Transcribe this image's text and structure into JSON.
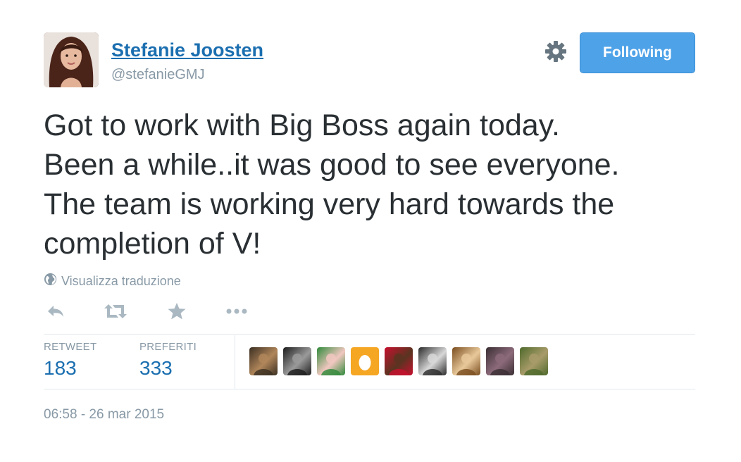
{
  "user": {
    "name": "Stefanie Joosten",
    "handle": "@stefanieGMJ"
  },
  "header": {
    "settings_icon": "gear-icon",
    "follow_label": "Following",
    "follow_color": "#4ea2e8"
  },
  "tweet": {
    "text": "Got to work with Big Boss again today.\nBeen a while..it was good to see everyone.\nThe team is working very hard towards the\ncompletion of V!",
    "translate_label": "Visualizza traduzione",
    "translate_icon": "globe-icon"
  },
  "actions": [
    {
      "name": "reply-icon"
    },
    {
      "name": "retweet-icon"
    },
    {
      "name": "favorite-star-icon"
    },
    {
      "name": "more-dots-icon"
    }
  ],
  "stats": {
    "retweets": {
      "label": "RETWEET",
      "value": "183"
    },
    "favorites": {
      "label": "PREFERITI",
      "value": "333"
    }
  },
  "favoriters": [
    {
      "name": "avatar-1",
      "colors": [
        "#3b2f22",
        "#b0865a"
      ]
    },
    {
      "name": "avatar-2",
      "colors": [
        "#1c1c1c",
        "#9a9a9a"
      ]
    },
    {
      "name": "avatar-3",
      "colors": [
        "#2f8a3a",
        "#f1c7c0"
      ]
    },
    {
      "name": "avatar-4-egg",
      "colors": [
        "#f5a623",
        "#ffffff"
      ]
    },
    {
      "name": "avatar-5",
      "colors": [
        "#c8102e",
        "#5a3420"
      ]
    },
    {
      "name": "avatar-6",
      "colors": [
        "#2b2b2b",
        "#d8d8d8"
      ]
    },
    {
      "name": "avatar-7",
      "colors": [
        "#7a4d1f",
        "#e8c89a"
      ]
    },
    {
      "name": "avatar-8",
      "colors": [
        "#3a2e33",
        "#8c6a7a"
      ]
    },
    {
      "name": "avatar-9",
      "colors": [
        "#4f6a2c",
        "#a89b6a"
      ]
    }
  ],
  "timestamp": "06:58 - 26 mar 2015"
}
